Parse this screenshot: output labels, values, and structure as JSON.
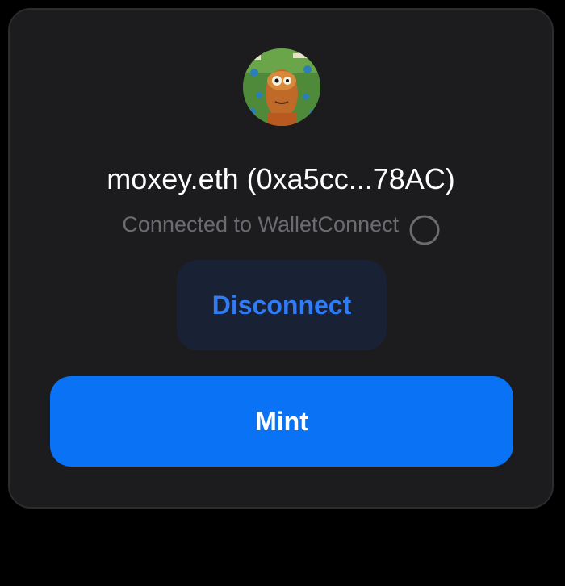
{
  "account": {
    "display_name": "moxey.eth (0xa5cc...78AC)",
    "avatar_icon": "nft-avatar-image"
  },
  "connection": {
    "status_text": "Connected to WalletConnect",
    "status_icon": "loading-spinner-icon"
  },
  "actions": {
    "disconnect_label": "Disconnect",
    "mint_label": "Mint"
  },
  "colors": {
    "background": "#000000",
    "card": "#1c1c1e",
    "accent": "#0a72f5",
    "disconnect_bg": "#192235",
    "disconnect_text": "#2f7cf6",
    "muted_text": "#6b6b70"
  }
}
